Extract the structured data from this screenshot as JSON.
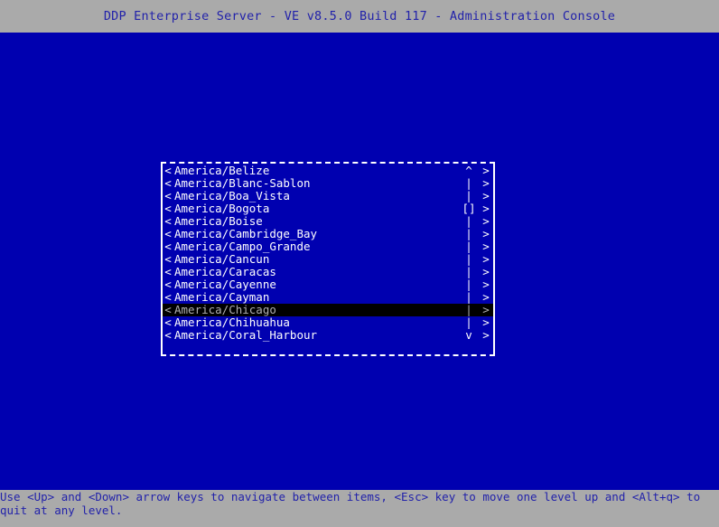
{
  "window": {
    "title": "DDP Enterprise Server - VE v8.5.0 Build 117 - Administration Console"
  },
  "colors": {
    "desktop_background": "#0000b0",
    "titlebar_background": "#aaaaaa",
    "titlebar_text": "#2222aa",
    "statusbar_background": "#aaaaaa",
    "statusbar_text": "#2222aa",
    "item_text": "#ffffff",
    "selected_background": "#000000",
    "selected_text": "#b0b0b0",
    "border": "#ffffff"
  },
  "listbox": {
    "left_marker": "<",
    "right_marker": ">",
    "scroll": {
      "up_arrow": "^",
      "down_arrow": "v",
      "track": "|",
      "thumb": "[]",
      "thumb_row_index": 3
    },
    "items": [
      {
        "label": "America/Belize",
        "selected": false,
        "scroll": "^"
      },
      {
        "label": "America/Blanc-Sablon",
        "selected": false,
        "scroll": "|"
      },
      {
        "label": "America/Boa_Vista",
        "selected": false,
        "scroll": "|"
      },
      {
        "label": "America/Bogota",
        "selected": false,
        "scroll": "[]"
      },
      {
        "label": "America/Boise",
        "selected": false,
        "scroll": "|"
      },
      {
        "label": "America/Cambridge_Bay",
        "selected": false,
        "scroll": "|"
      },
      {
        "label": "America/Campo_Grande",
        "selected": false,
        "scroll": "|"
      },
      {
        "label": "America/Cancun",
        "selected": false,
        "scroll": "|"
      },
      {
        "label": "America/Caracas",
        "selected": false,
        "scroll": "|"
      },
      {
        "label": "America/Cayenne",
        "selected": false,
        "scroll": "|"
      },
      {
        "label": "America/Cayman",
        "selected": false,
        "scroll": "|"
      },
      {
        "label": "America/Chicago",
        "selected": true,
        "scroll": "|"
      },
      {
        "label": "America/Chihuahua",
        "selected": false,
        "scroll": "|"
      },
      {
        "label": "America/Coral_Harbour",
        "selected": false,
        "scroll": "v"
      }
    ]
  },
  "statusbar": {
    "text": "Use <Up> and <Down> arrow keys to navigate between items, <Esc> key to move one level up and <Alt+q> to quit at any level."
  }
}
